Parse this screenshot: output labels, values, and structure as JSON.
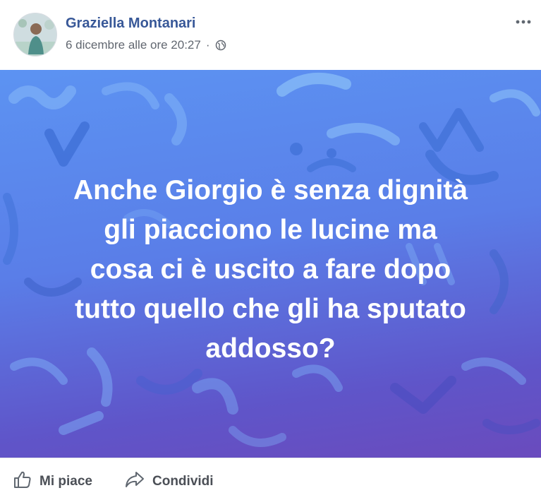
{
  "post": {
    "author": "Graziella Montanari",
    "timestamp": "6 dicembre alle ore 20:27",
    "separator": "·",
    "privacy_icon": "globe-icon",
    "more_icon": "more-options-icon",
    "text_lines": [
      "Anche Giorgio è senza dignità",
      "gli piacciono le lucine ma",
      "cosa ci è uscito a fare dopo",
      "tutto quello che gli ha sputato",
      "addosso?"
    ],
    "background_colors": [
      "#5c93f2",
      "#6a4bbd"
    ]
  },
  "actions": {
    "like_label": "Mi piace",
    "share_label": "Condividi"
  },
  "colors": {
    "author_link": "#385898",
    "meta_text": "#616770",
    "action_text": "#4b4f56"
  }
}
